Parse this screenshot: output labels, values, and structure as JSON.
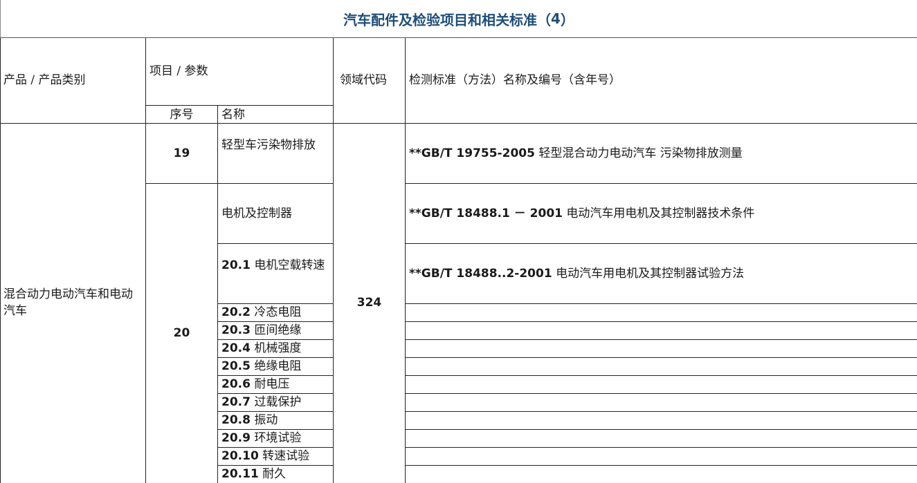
{
  "title_text": "汽车配件及检验项目和相关标准（",
  "title_num": "4",
  "title_close": "）",
  "header": {
    "product": "产品 / 产品类别",
    "item_param": "项目 / 参数",
    "seq": "序号",
    "name": "名称",
    "domain_code": "领域代码",
    "standard": "检测标准（方法）名称及编号（含年号）"
  },
  "product_category": "混合动力电动汽车和电动汽车",
  "domain_code_value": "324",
  "rows": {
    "r19": {
      "seq": "19",
      "name": "轻型车污染物排放",
      "std_code": "**GB/T 19755-2005",
      "std_name": " 轻型混合动力电动汽车 污染物排放测量"
    },
    "r20": {
      "seq": "20",
      "name": "电机及控制器",
      "std_code": "**GB/T 18488.1 － 2001",
      "std_name": " 电动汽车用电机及其控制器技术条件"
    },
    "r20_1": {
      "num": "20.1",
      "name": " 电机空载转速",
      "std_code": "**GB/T 18488..2-2001",
      "std_name": " 电动汽车用电机及其控制器试验方法"
    },
    "subs": [
      {
        "num": "20.2",
        "name": " 冷态电阻"
      },
      {
        "num": "20.3",
        "name": " 匝间绝缘"
      },
      {
        "num": "20.4",
        "name": " 机械强度"
      },
      {
        "num": "20.5",
        "name": " 绝缘电阻"
      },
      {
        "num": "20.6",
        "name": " 耐电压"
      },
      {
        "num": "20.7",
        "name": " 过载保护"
      },
      {
        "num": "20.8",
        "name": " 振动"
      },
      {
        "num": "20.9",
        "name": " 环境试验"
      },
      {
        "num": "20.10",
        "name": " 转速试验"
      },
      {
        "num": "20.11",
        "name": " 耐久"
      }
    ]
  }
}
